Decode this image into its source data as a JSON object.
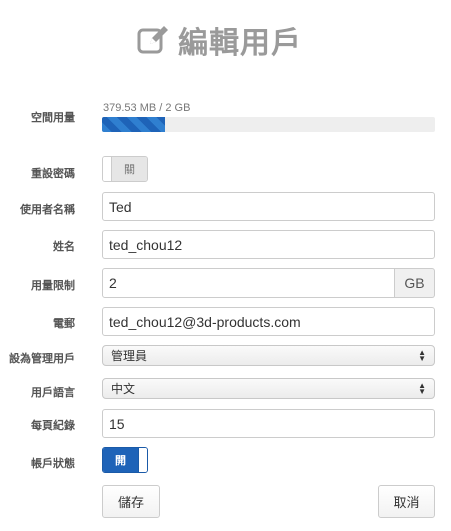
{
  "page": {
    "title": "編輯用戶",
    "title_icon": "edit-icon"
  },
  "storage": {
    "label": "空間用量",
    "usage_text": "379.53 MB / 2 GB",
    "used_fraction": 0.19
  },
  "reset_password": {
    "label": "重設密碼",
    "state_label": "關",
    "on": false
  },
  "username": {
    "label": "使用者名稱",
    "value": "Ted"
  },
  "full_name": {
    "label": "姓名",
    "value": "ted_chou12"
  },
  "quota": {
    "label": "用量限制",
    "value": "2",
    "unit": "GB"
  },
  "email": {
    "label": "電郵",
    "value": "ted_chou12@3d-products.com"
  },
  "admin": {
    "label": "設為管理用戶",
    "selected": "管理員"
  },
  "language": {
    "label": "用戶語言",
    "selected": "中文"
  },
  "records_per_page": {
    "label": "每頁紀錄",
    "value": "15"
  },
  "account_status": {
    "label": "帳戶狀態",
    "state_label": "開",
    "on": true
  },
  "actions": {
    "save_label": "儲存",
    "cancel_label": "取消"
  },
  "colors": {
    "accent": "#1e63b8",
    "progress_fill": "#2f7fd0",
    "title_gray": "#9a9a9a"
  }
}
